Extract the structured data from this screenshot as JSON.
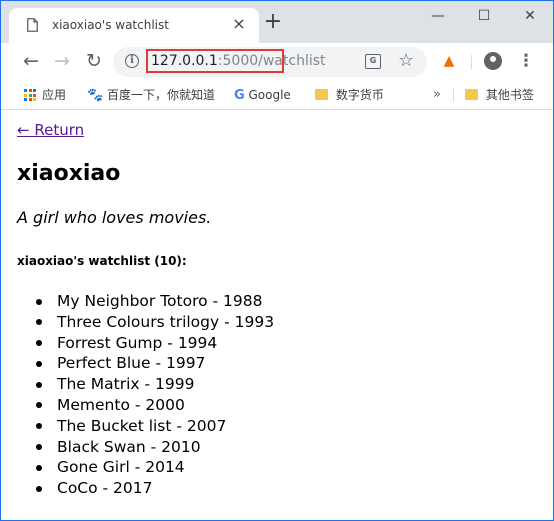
{
  "browser": {
    "tab_title": "xiaoxiao's watchlist",
    "new_tab": "+",
    "window_controls": {
      "minimize": "—",
      "maximize": "☐",
      "close": "✕"
    },
    "url_host": "127.0.0.1",
    "url_rest": ":5000/watchlist",
    "bookmarks": [
      {
        "label": "应用",
        "icon": "apps-grid-icon"
      },
      {
        "label": "百度一下，你就知道",
        "icon": "paw-icon"
      },
      {
        "label": "Google",
        "icon": "google-icon"
      },
      {
        "label": "数字货币",
        "icon": "folder-icon"
      },
      {
        "label": "其他书签",
        "icon": "folder-icon"
      }
    ],
    "overflow_chevron": "»",
    "accent_color": "#1a73e8",
    "highlight_color": "#e53935"
  },
  "page": {
    "return_link": "← Return",
    "user_name": "xiaoxiao",
    "bio": "A girl who loves movies.",
    "list_heading": "xiaoxiao's watchlist (10):",
    "movies": [
      "My Neighbor Totoro - 1988",
      "Three Colours trilogy - 1993",
      "Forrest Gump - 1994",
      "Perfect Blue - 1997",
      "The Matrix - 1999",
      "Memento - 2000",
      "The Bucket list - 2007",
      "Black Swan - 2010",
      "Gone Girl - 2014",
      "CoCo - 2017"
    ]
  }
}
